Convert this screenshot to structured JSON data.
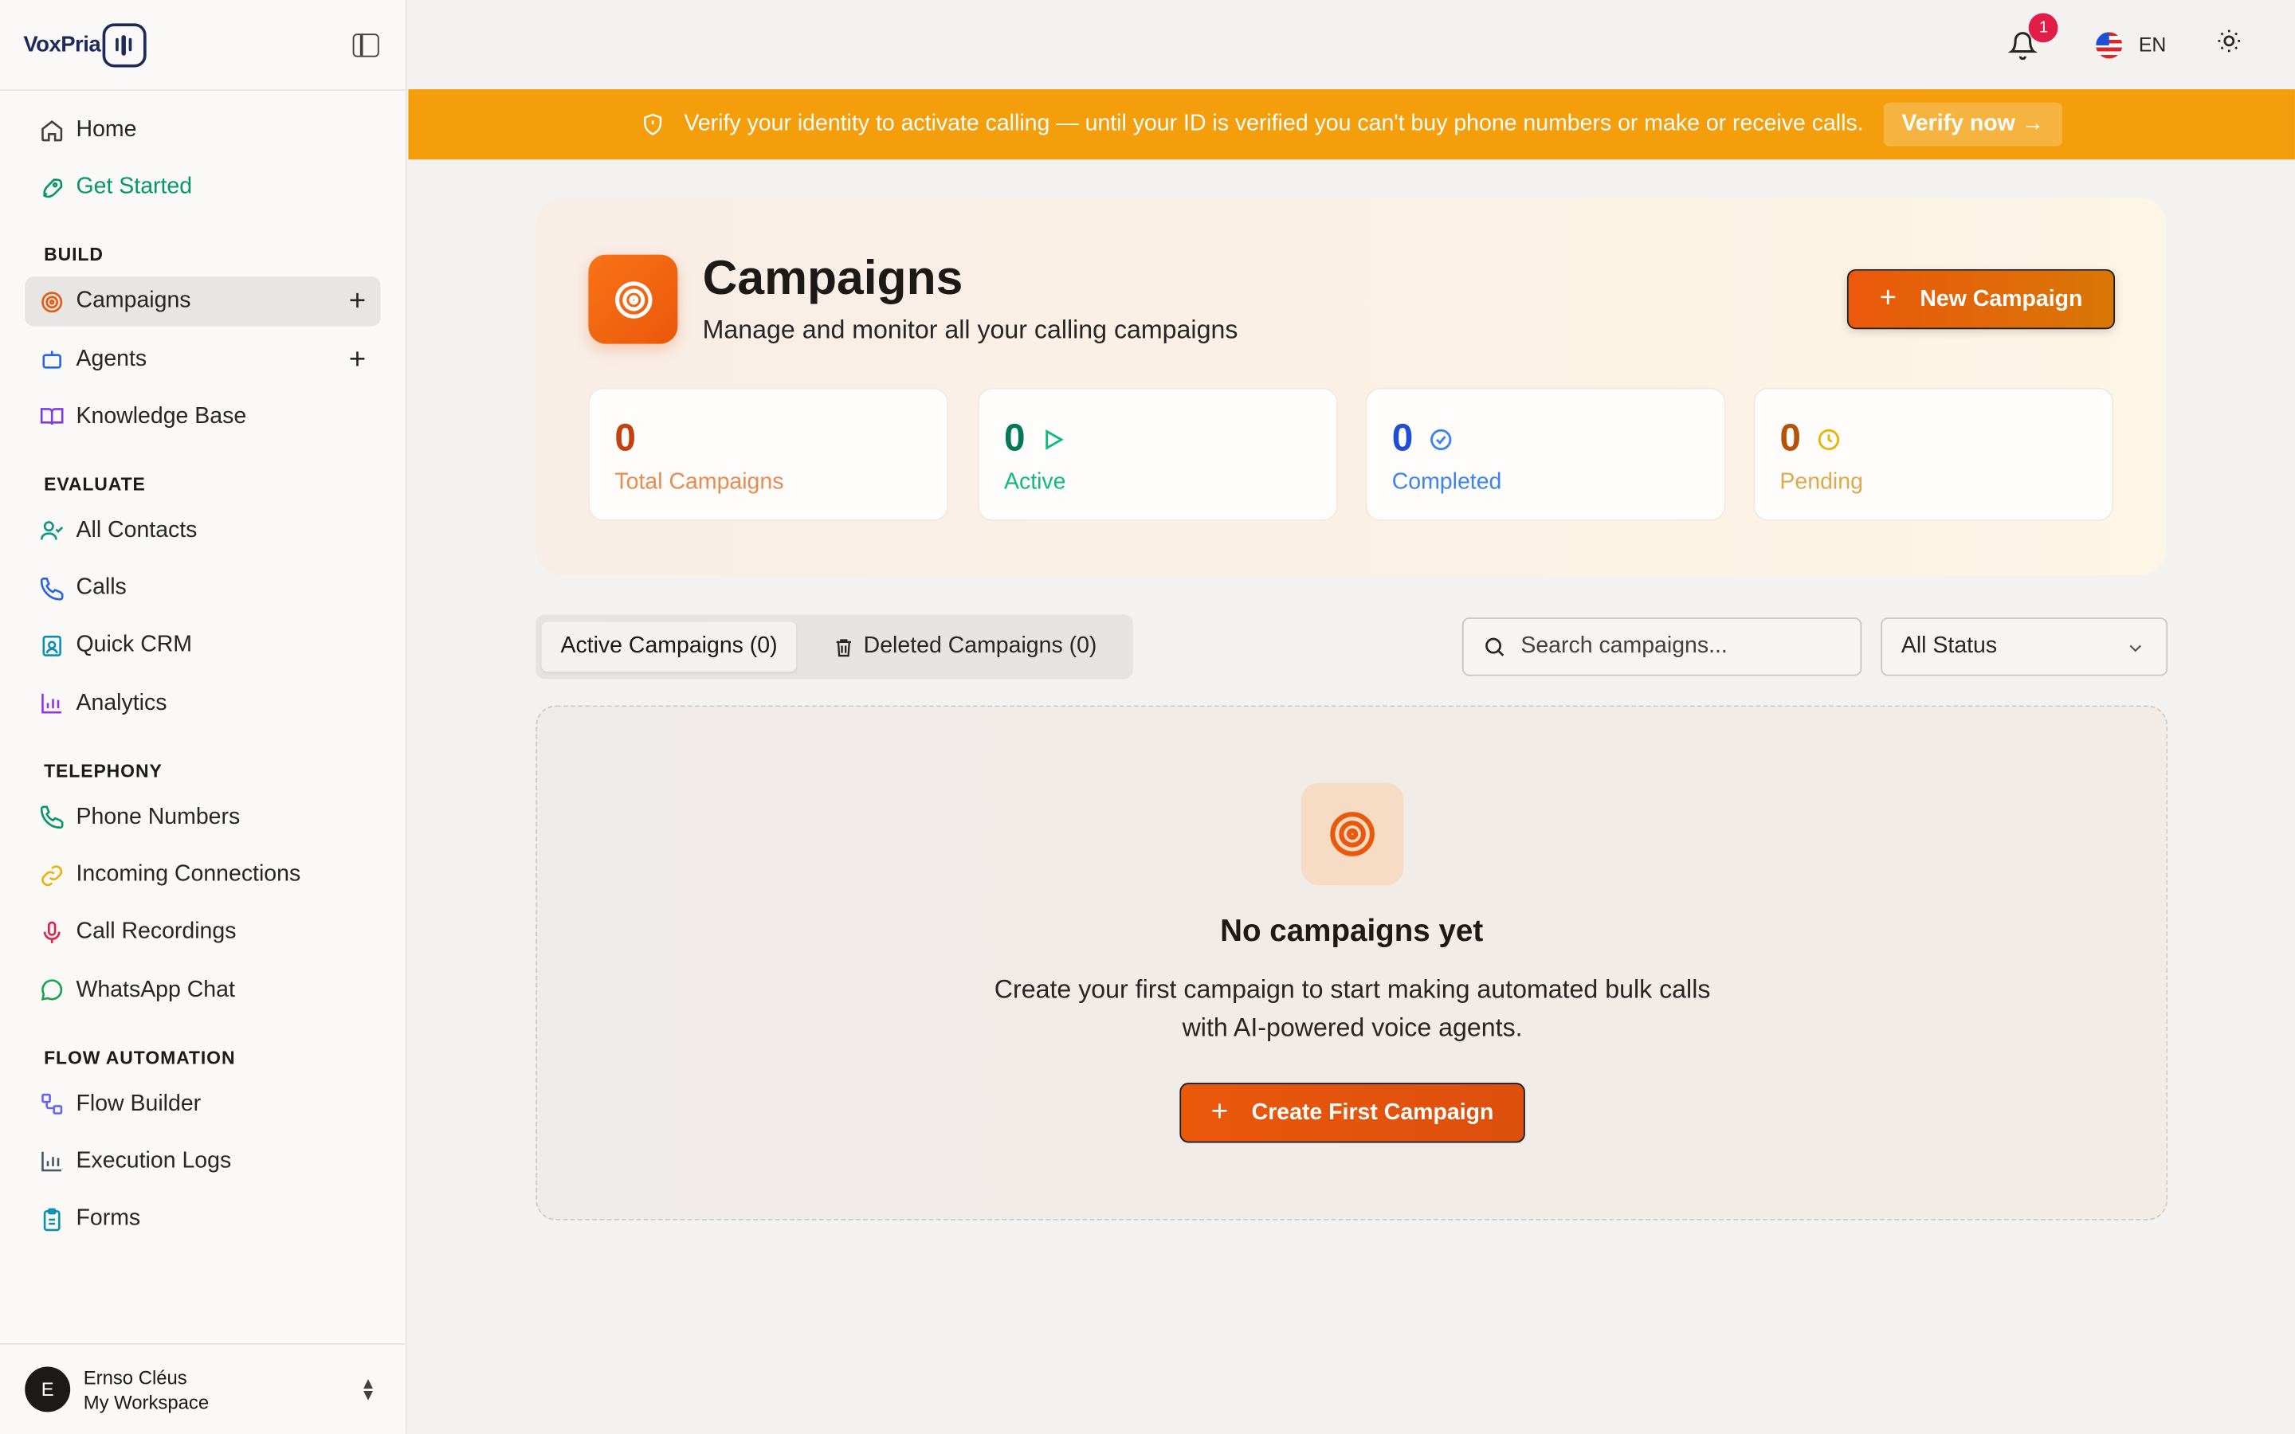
{
  "brand": {
    "name": "VoxPria"
  },
  "sidebar": {
    "top_items": [
      {
        "label": "Home",
        "icon": "home-icon"
      },
      {
        "label": "Get Started",
        "icon": "rocket-icon"
      }
    ],
    "sections": [
      {
        "title": "BUILD",
        "items": [
          {
            "label": "Campaigns",
            "icon": "target-icon",
            "active": true,
            "has_add": true
          },
          {
            "label": "Agents",
            "icon": "bot-icon",
            "has_add": true
          },
          {
            "label": "Knowledge Base",
            "icon": "book-icon"
          }
        ]
      },
      {
        "title": "EVALUATE",
        "items": [
          {
            "label": "All Contacts",
            "icon": "user-check-icon"
          },
          {
            "label": "Calls",
            "icon": "phone-icon"
          },
          {
            "label": "Quick CRM",
            "icon": "contact-card-icon"
          },
          {
            "label": "Analytics",
            "icon": "bar-chart-icon"
          }
        ]
      },
      {
        "title": "TELEPHONY",
        "items": [
          {
            "label": "Phone Numbers",
            "icon": "phone-icon"
          },
          {
            "label": "Incoming Connections",
            "icon": "link-icon"
          },
          {
            "label": "Call Recordings",
            "icon": "mic-icon"
          },
          {
            "label": "WhatsApp Chat",
            "icon": "chat-bubble-icon"
          }
        ]
      },
      {
        "title": "FLOW AUTOMATION",
        "items": [
          {
            "label": "Flow Builder",
            "icon": "workflow-icon"
          },
          {
            "label": "Execution Logs",
            "icon": "bar-chart-icon"
          },
          {
            "label": "Forms",
            "icon": "clipboard-icon"
          }
        ]
      }
    ],
    "user": {
      "initial": "E",
      "name": "Ernso Cléus",
      "workspace": "My Workspace"
    }
  },
  "topbar": {
    "notification_count": "1",
    "language": "EN"
  },
  "banner": {
    "message": "Verify your identity to activate calling — until your ID is verified you can't buy phone numbers or make or receive calls.",
    "action_label": "Verify now →"
  },
  "header": {
    "title": "Campaigns",
    "subtitle": "Manage and monitor all your calling campaigns",
    "new_button_label": "New Campaign"
  },
  "stats": [
    {
      "value": "0",
      "label": "Total Campaigns",
      "color": "#c2410c",
      "label_color": "#ea8a4f"
    },
    {
      "value": "0",
      "label": "Active",
      "color": "#047857",
      "label_color": "#10b981"
    },
    {
      "value": "0",
      "label": "Completed",
      "color": "#1d4ed8",
      "label_color": "#3b82f6"
    },
    {
      "value": "0",
      "label": "Pending",
      "color": "#b45309",
      "label_color": "#e0a84a"
    }
  ],
  "tabs": {
    "active_label": "Active Campaigns (0)",
    "deleted_label": "Deleted Campaigns (0)"
  },
  "filters": {
    "search_placeholder": "Search campaigns...",
    "status_value": "All Status"
  },
  "empty_state": {
    "title": "No campaigns yet",
    "description": "Create your first campaign to start making automated bulk calls with AI-powered voice agents.",
    "button_label": "Create First Campaign"
  },
  "colors": {
    "accent": "#ea580c",
    "banner": "#f59e0b",
    "active_nav": "#e8e6e5"
  }
}
